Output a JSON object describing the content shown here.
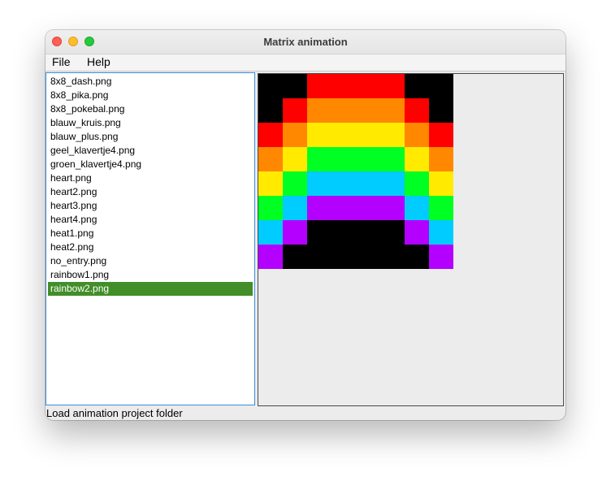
{
  "window": {
    "title": "Matrix animation"
  },
  "menu": {
    "file": "File",
    "help": "Help"
  },
  "files": [
    "8x8_dash.png",
    "8x8_pika.png",
    "8x8_pokebal.png",
    "blauw_kruis.png",
    "blauw_plus.png",
    "geel_klavertje4.png",
    "groen_klavertje4.png",
    "heart.png",
    "heart2.png",
    "heart3.png",
    "heart4.png",
    "heat1.png",
    "heat2.png",
    "no_entry.png",
    "rainbow1.png",
    "rainbow2.png"
  ],
  "selected_file": "rainbow2.png",
  "colors": {
    "selection": "#428e29",
    "list_focus_border": "#3a8fd8",
    "K": "#000000",
    "R": "#ff0000",
    "O": "#ff8800",
    "Y": "#ffea00",
    "G": "#00ff22",
    "C": "#00ccff",
    "P": "#b300ff"
  },
  "matrix": [
    [
      "K",
      "K",
      "R",
      "R",
      "R",
      "R",
      "K",
      "K"
    ],
    [
      "K",
      "R",
      "O",
      "O",
      "O",
      "O",
      "R",
      "K"
    ],
    [
      "R",
      "O",
      "Y",
      "Y",
      "Y",
      "Y",
      "O",
      "R"
    ],
    [
      "O",
      "Y",
      "G",
      "G",
      "G",
      "G",
      "Y",
      "O"
    ],
    [
      "Y",
      "G",
      "C",
      "C",
      "C",
      "C",
      "G",
      "Y"
    ],
    [
      "G",
      "C",
      "P",
      "P",
      "P",
      "P",
      "C",
      "G"
    ],
    [
      "C",
      "P",
      "K",
      "K",
      "K",
      "K",
      "P",
      "C"
    ],
    [
      "P",
      "K",
      "K",
      "K",
      "K",
      "K",
      "K",
      "P"
    ]
  ],
  "status": {
    "text": "Load animation project folder"
  }
}
